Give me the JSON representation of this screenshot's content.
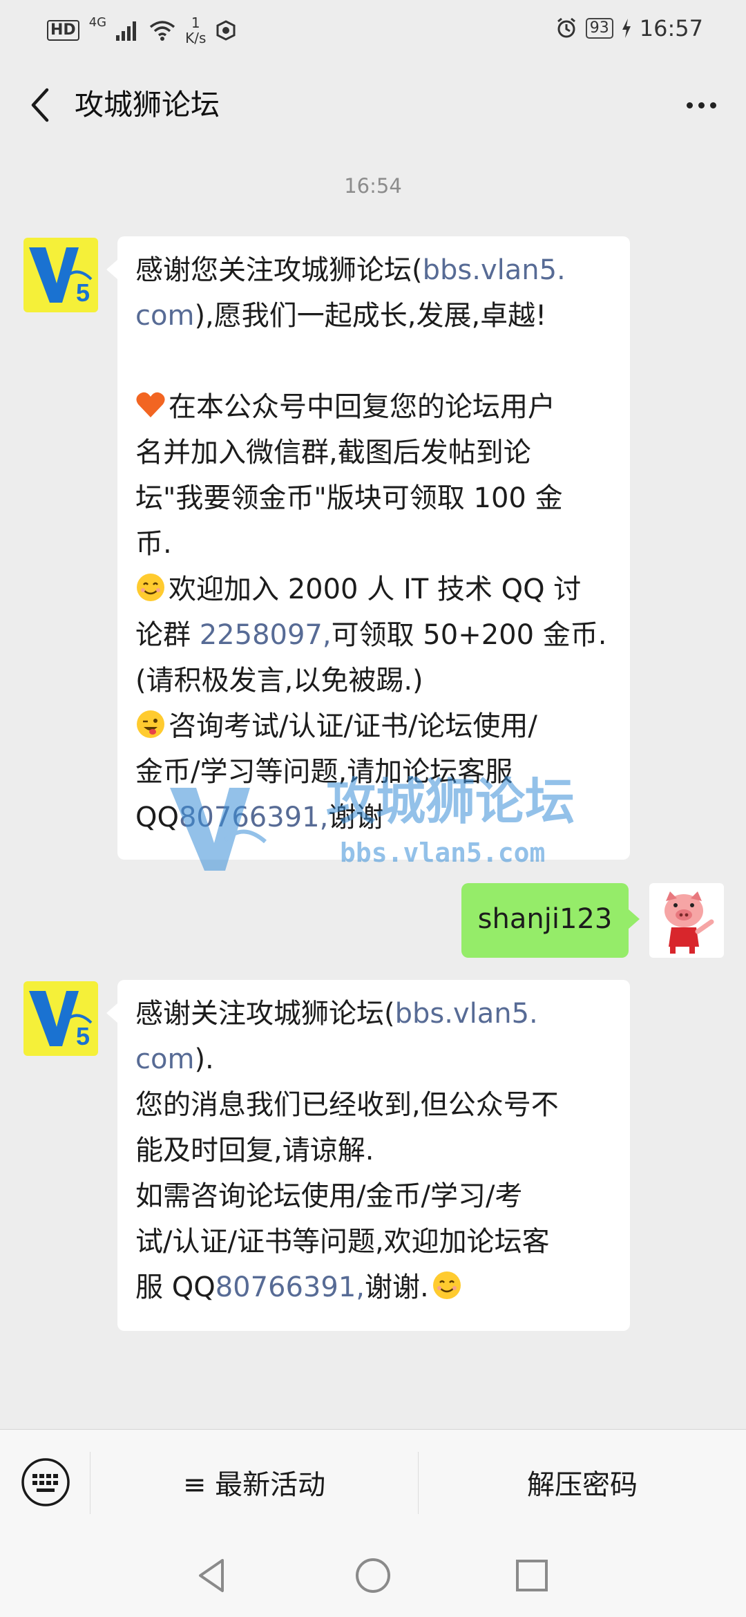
{
  "status_bar": {
    "hd": "HD",
    "network": "4G",
    "speed_value": "1",
    "speed_unit": "K/s",
    "battery": "93",
    "time": "16:57"
  },
  "header": {
    "title": "攻城狮论坛"
  },
  "chat": {
    "timestamp": "16:54",
    "messages": [
      {
        "sender": "official-account",
        "lines": [
          [
            "感谢您关注攻城狮论坛(",
            "bbs.vlan5."
          ],
          [
            "com",
            "),愿我们一起成长,发展,卓越!"
          ],
          [
            "在本公众号中回复您的论坛用户"
          ],
          [
            "名并加入微信群,截图后发帖到论"
          ],
          [
            "坛\"我要领金币\"版块可领取 100 金"
          ],
          [
            "币."
          ],
          [
            "欢迎加入 2000 人 IT 技术 QQ 讨"
          ],
          [
            "论群 ",
            "2258097,",
            "可领取 50+200 金币."
          ],
          [
            "(请积极发言,以免被踢.)"
          ],
          [
            "咨询考试/认证/证书/论坛使用/"
          ],
          [
            "金币/学习等问题,请加论坛客服"
          ],
          [
            "QQ",
            "80766391,",
            "谢谢"
          ]
        ]
      },
      {
        "sender": "me",
        "text": "shanji123"
      },
      {
        "sender": "official-account",
        "lines": [
          [
            "感谢关注攻城狮论坛(",
            "bbs.vlan5."
          ],
          [
            "com",
            ")."
          ],
          [
            "您的消息我们已经收到,但公众号不"
          ],
          [
            "能及时回复,请谅解."
          ],
          [
            "如需咨询论坛使用/金币/学习/考"
          ],
          [
            "试/认证/证书等问题,欢迎加论坛客"
          ],
          [
            "服 QQ",
            "80766391,",
            "谢谢."
          ]
        ]
      }
    ],
    "watermark": {
      "title": "攻城狮论坛",
      "url": "bbs.vlan5.com"
    }
  },
  "menu": {
    "item1": "≡ 最新活动",
    "item2": "解压密码"
  },
  "colors": {
    "link": "#576b95",
    "outgoing_bubble": "#95ec69",
    "background": "#ededed"
  }
}
